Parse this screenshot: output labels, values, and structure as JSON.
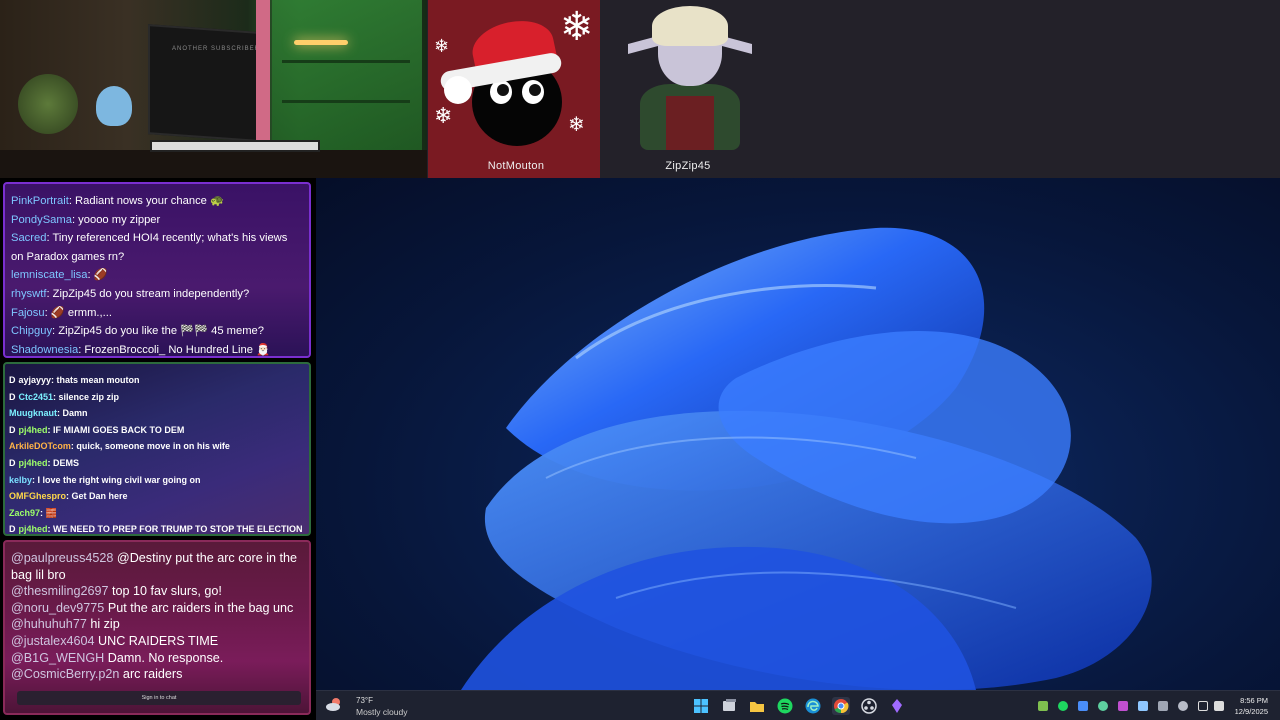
{
  "participants": [
    {
      "name": "NotMouton"
    },
    {
      "name": "ZipZip45"
    }
  ],
  "webcam": {
    "sign_text": "ANOTHER SUBSCRIBER"
  },
  "chat_primary": {
    "messages": [
      {
        "user": "PinkPortrait",
        "text": ": Radiant nows your chance 🐢"
      },
      {
        "user": "PondySama",
        "text": ": yoooo my zipper"
      },
      {
        "user": "Sacred",
        "text": ": Tiny referenced HOI4 recently; what's his views"
      },
      {
        "user": "",
        "text": "on Paradox games rn?"
      },
      {
        "user": "lemniscate_lisa",
        "text": ": 🏈"
      },
      {
        "user": "rhyswtf",
        "text": ": ZipZip45 do you stream independently?"
      },
      {
        "user": "Fajosu",
        "text": ": 🏈 ermm.,..."
      },
      {
        "user": "Chipguy",
        "text": ": ZipZip45 do you like the 🏁🏁 45 meme?"
      },
      {
        "user": "Shadownesia",
        "text": ": FrozenBroccoli_ No Hundred Line 🎅🏻"
      }
    ]
  },
  "chat_secondary": {
    "messages": [
      {
        "badge": "D",
        "user": "ayjayyy",
        "text": ": thats mean mouton",
        "color": "#ffffff"
      },
      {
        "badge": "D",
        "user": "Ctc2451",
        "text": ": silence zip zip",
        "color": "#7cf0ff"
      },
      {
        "badge": "",
        "user": "Muugknaut",
        "text": ": Damn",
        "color": "#7cf0ff"
      },
      {
        "badge": "D",
        "user": "pj4hed",
        "text": ": IF MIAMI GOES BACK TO DEM",
        "color": "#9dff6a"
      },
      {
        "badge": "",
        "user": "ArkileDOTcom",
        "text": ": quick, someone move in on his wife",
        "color": "#ffb347"
      },
      {
        "badge": "D",
        "user": "pj4hed",
        "text": ": DEMS",
        "color": "#9dff6a"
      },
      {
        "badge": "",
        "user": "kelby",
        "text": ": I love the right wing civil war going on",
        "color": "#7ce0ff"
      },
      {
        "badge": "",
        "user": "OMFGhespro",
        "text": ": Get Dan here",
        "color": "#ffd84a"
      },
      {
        "badge": "",
        "user": "Zach97",
        "text": ": 🧱",
        "color": "#9dff6a"
      },
      {
        "badge": "D",
        "user": "pj4hed",
        "text": ": WE NEED TO PREP FOR TRUMP TO STOP THE ELECTION",
        "color": "#9dff6a"
      }
    ]
  },
  "chat_tertiary": {
    "messages": [
      {
        "user": "@paulpreuss4528",
        "text": " @Destiny put the arc core in the bag lil bro"
      },
      {
        "user": "@thesmiling2697",
        "text": " top 10 fav slurs, go!"
      },
      {
        "user": "@noru_dev9775",
        "text": " Put the arc raiders in the bag unc"
      },
      {
        "user": "@huhuhuh77",
        "text": " hi zip"
      },
      {
        "user": "@justalex4604",
        "text": " UNC RAIDERS TIME"
      },
      {
        "user": "@B1G_WENGH",
        "text": " Damn. No response."
      },
      {
        "user": "@CosmicBerry.p2n",
        "text": " arc raiders"
      }
    ],
    "sign_in_label": "Sign in to chat"
  },
  "taskbar": {
    "weather": {
      "temp": "73°F",
      "condition": "Mostly cloudy"
    },
    "apps": [
      "start",
      "task-view",
      "file-explorer",
      "spotify",
      "edge",
      "chrome",
      "obs",
      "app-purple"
    ],
    "clock": {
      "time": "8:56 PM",
      "date": "12/9/2025"
    }
  }
}
